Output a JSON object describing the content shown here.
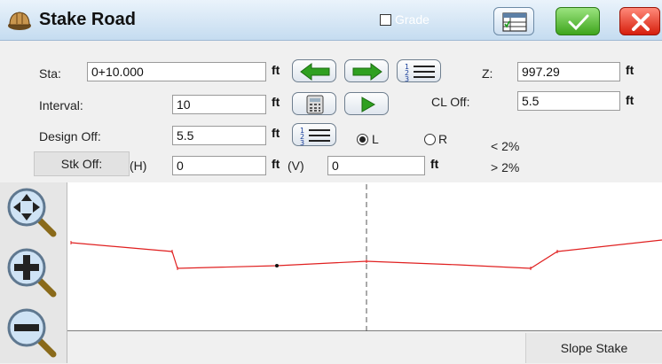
{
  "title": "Stake Road",
  "grade_label": "Grade",
  "fields": {
    "sta_label": "Sta:",
    "sta_value": "0+10.000",
    "sta_unit": "ft",
    "z_label": "Z:",
    "z_value": "997.29",
    "z_unit": "ft",
    "interval_label": "Interval:",
    "interval_value": "10",
    "interval_unit": "ft",
    "cl_off_label": "CL Off:",
    "cl_off_value": "5.5",
    "cl_off_unit": "ft",
    "design_off_label": "Design Off:",
    "design_off_value": "5.5",
    "design_off_unit": "ft",
    "radio_l_label": "L",
    "radio_r_label": "R",
    "slope_lt": "< 2%",
    "slope_gt": "> 2%",
    "stk_off_label": "Stk Off:",
    "h_label": "(H)",
    "h_value": "0",
    "h_unit": "ft",
    "v_label": "(V)",
    "v_value": "0",
    "v_unit": "ft"
  },
  "slope_stake_label": "Slope Stake",
  "colors": {
    "profile_line": "#e02020",
    "centerline": "#555555"
  },
  "icons": [
    "hardhat-icon",
    "spreadsheet-icon",
    "checkmark-icon",
    "close-icon",
    "arrow-left-icon",
    "arrow-right-icon",
    "list-icon",
    "calculator-icon",
    "play-icon",
    "zoom-pan-icon",
    "zoom-in-icon",
    "zoom-out-icon"
  ]
}
